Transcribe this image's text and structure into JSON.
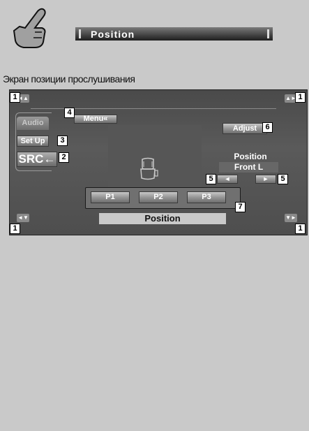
{
  "header": {
    "title": "Position"
  },
  "subtitle": "Экран позиции прослушивания",
  "screen": {
    "tab_audio": "Audio",
    "setup_button": "Set Up",
    "src_button": "SRC←",
    "menu_button": "Menu«",
    "adjust_button": "Adjust",
    "position_label": "Position",
    "position_value": "Front L",
    "arrow_left": "◄",
    "arrow_right": "►",
    "presets": [
      "P1",
      "P2",
      "P3"
    ],
    "bottom_label": "Position",
    "corner_buttons": [
      "◄▲",
      "▲►",
      "◄▼",
      "▼►"
    ]
  },
  "callouts": {
    "c1a": "1",
    "c1b": "1",
    "c1c": "1",
    "c1d": "1",
    "c2": "2",
    "c3": "3",
    "c4": "4",
    "c5a": "5",
    "c5b": "5",
    "c6": "6",
    "c7": "7"
  },
  "icons": {
    "hand": "pointing-hand-icon",
    "seat": "car-seat-icon"
  },
  "colors": {
    "page_bg": "#c9c9c9",
    "screen_bg": "#4a4a4a",
    "header_bar": "#4c4c4c"
  }
}
